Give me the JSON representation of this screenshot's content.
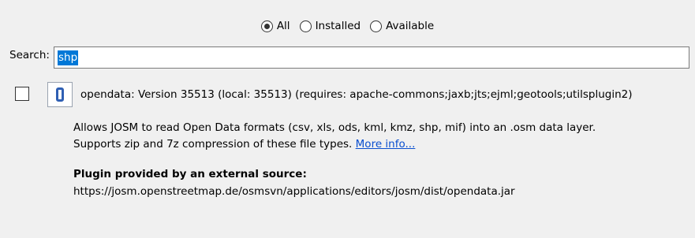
{
  "filter": {
    "options": [
      {
        "label": "All",
        "selected": true
      },
      {
        "label": "Installed",
        "selected": false
      },
      {
        "label": "Available",
        "selected": false
      }
    ]
  },
  "search": {
    "label": "Search:",
    "value": "shp"
  },
  "plugin": {
    "checked": false,
    "icon": "plugin-icon",
    "title": "opendata: Version 35513 (local: 35513) (requires: apache-commons;jaxb;jts;ejml;geotools;utilsplugin2)",
    "description_line1": "Allows JOSM to read Open Data formats (csv, xls, ods, kml, kmz, shp, mif) into an .osm data layer.",
    "description_line2": "Supports zip and 7z compression of these file types. ",
    "more_info": "More info...",
    "source_heading": "Plugin provided by an external source:",
    "source_url": "https://josm.openstreetmap.de/osmsvn/applications/editors/josm/dist/opendata.jar"
  },
  "colors": {
    "background": "#f0f0f0",
    "selection": "#0078d7",
    "link": "#0a4fcf"
  }
}
